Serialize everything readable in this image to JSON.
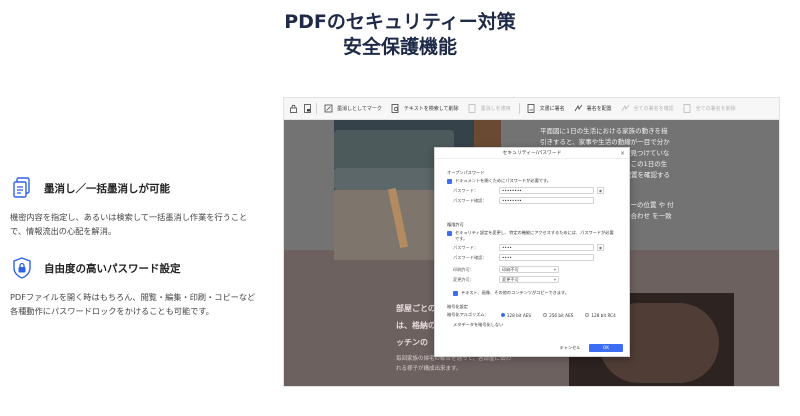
{
  "hero": {
    "line1": "PDFのセキュリティー対策",
    "line2": "安全保護機能"
  },
  "features": [
    {
      "title": "墨消し／一括墨消しが可能",
      "desc": "機密内容を指定し、あるいは検索して一括墨消し作業を行うことで、情報流出の心配を解消。"
    },
    {
      "title": "自由度の高いパスワード設定",
      "desc": "PDFファイルを開く時はもちろん、閲覧・編集・印刷・コピーなど各種動作にパスワードロックをかけることも可能です。"
    }
  ],
  "toolbar": {
    "mark_redaction": "墨消しとしてマーク",
    "search_redact": "テキストを検索して削除",
    "apply_redaction": "墨消しを適用",
    "sign_doc": "文書に署名",
    "verify_sign": "署名を配置",
    "clear_all": "全ての署名を確認",
    "clear_all2": "全ての署名を削除"
  },
  "document": {
    "right_text": "平面図に1日の生活における家族の動きを描引きすると、家事や生活の動線が一目で分かります。間取りと動線に問題が見つけていない人も、より複雑に出かかわるこの1日の生活の通路の位置関係や部屋の配置を確認することで確認します",
    "right_text2": "ニーの位置 や 付け合わせ を一致",
    "bottom_heading": "部屋ごとの、は、格納の、キッチンの",
    "bottom_small": "毎回家族の帰宅の都合を通って、各部屋に伝われる様子が構成出来ます。"
  },
  "dialog": {
    "title": "セキュリティー/パスワード",
    "close": "×",
    "open_section": "オープンパスワード",
    "open_check": "ドキュメントを開くためにパスワードが必要です。",
    "pw_label": "パスワード：",
    "pw_value": "••••••••",
    "pw_confirm_label": "パスワード確認：",
    "pw_confirm_value": "••••••••",
    "perm_section": "権限許可",
    "perm_check": "セキュリティ設定を変更し、特定の機能にアクセスするためには、パスワードが必要です。",
    "perm_pw_label": "パスワード：",
    "perm_pw_value": "••••",
    "perm_confirm_label": "パスワード確認：",
    "perm_confirm_value": "••••",
    "print_label": "印刷許可：",
    "print_value": "印刷不可",
    "change_label": "変更許可：",
    "change_value": "変更不可",
    "copy_check": "テキスト、画像、その他のコンテンツがコピーできます。",
    "enc_section": "暗号化設定",
    "enc_label": "暗号化アルゴリズム：",
    "enc_opt1": "128 bit AES",
    "enc_opt2": "256 bit AES",
    "enc_opt3": "128 bit RC4",
    "meta_label": "メタデータを暗号化しない",
    "cancel": "キャンセル",
    "ok": "OK"
  },
  "colors": {
    "accent": "#3d6df2",
    "title": "#1f2a48"
  }
}
